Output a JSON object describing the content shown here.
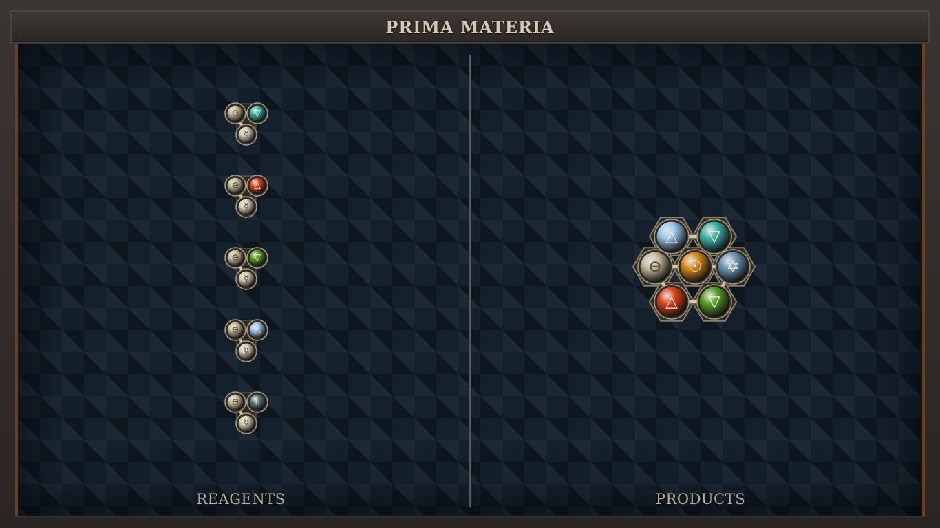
{
  "header": {
    "title": "PRIMA MATERIA"
  },
  "panels": {
    "reagents_label": "REAGENTS",
    "products_label": "PRODUCTS"
  },
  "elements": {
    "salt": {
      "symbol": "⊖",
      "color": "#c9bd9e"
    },
    "quicksilver": {
      "symbol": "☿",
      "color": "#d8cfb5"
    },
    "water": {
      "symbol": "▽",
      "color": "#3fb6a9"
    },
    "fire": {
      "symbol": "△",
      "color": "#e0431b"
    },
    "earth": {
      "symbol": "▽",
      "color": "#5aa226"
    },
    "air": {
      "symbol": "△",
      "color": "#9cc8ef"
    },
    "lead": {
      "symbol": "♄",
      "color": "#5f7780"
    },
    "gold": {
      "symbol": "☉",
      "color": "#d98a1c"
    },
    "vitae": {
      "symbol": "✡",
      "color": "#6f9ab8"
    }
  },
  "reagents": [
    {
      "name": "reagent-water",
      "atoms": [
        "salt",
        "water",
        "quicksilver"
      ]
    },
    {
      "name": "reagent-fire",
      "atoms": [
        "salt",
        "fire",
        "quicksilver"
      ]
    },
    {
      "name": "reagent-earth",
      "atoms": [
        "salt",
        "earth",
        "quicksilver"
      ]
    },
    {
      "name": "reagent-air",
      "atoms": [
        "salt",
        "air",
        "quicksilver"
      ]
    },
    {
      "name": "reagent-lead",
      "atoms": [
        "salt",
        "lead",
        "quicksilver"
      ]
    }
  ],
  "product": {
    "name": "product-molecule",
    "atoms": [
      "air",
      "water",
      "salt",
      "gold",
      "vitae",
      "fire",
      "earth"
    ]
  }
}
